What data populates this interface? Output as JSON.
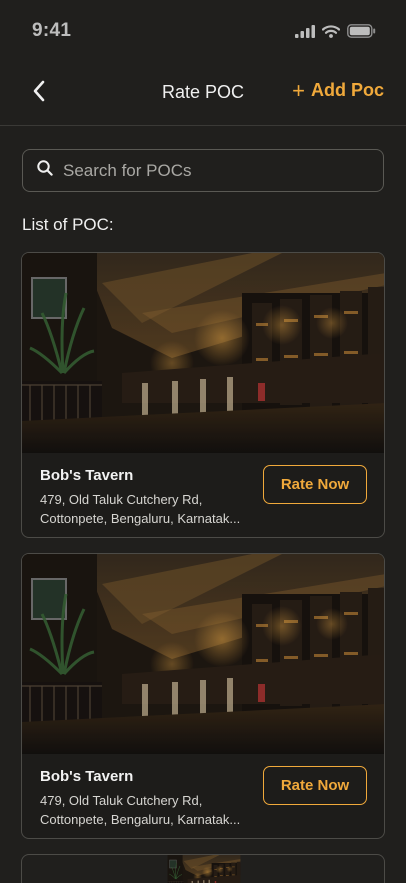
{
  "status_bar": {
    "time": "9:41",
    "icons": [
      "cellular-signal-icon",
      "wifi-icon",
      "battery-icon"
    ]
  },
  "nav": {
    "back_icon": "chevron-left-icon",
    "title": "Rate POC",
    "add_label": "Add Poc",
    "add_icon": "plus-icon"
  },
  "search": {
    "placeholder": "Search for POCs",
    "value": "",
    "icon": "search-icon"
  },
  "list": {
    "heading": "List of POC:",
    "items": [
      {
        "name": "Bob's Tavern",
        "address_line1": "479, Old Taluk Cutchery Rd,",
        "address_line2": "Cottonpete, Bengaluru, Karnatak...",
        "button_label": "Rate Now"
      },
      {
        "name": "Bob's Tavern",
        "address_line1": "479, Old Taluk Cutchery Rd,",
        "address_line2": "Cottonpete, Bengaluru, Karnatak...",
        "button_label": "Rate Now"
      }
    ]
  },
  "colors": {
    "background": "#201f1d",
    "accent": "#f0a93b",
    "border": "#4c4b47",
    "text": "#f2f2f2"
  }
}
